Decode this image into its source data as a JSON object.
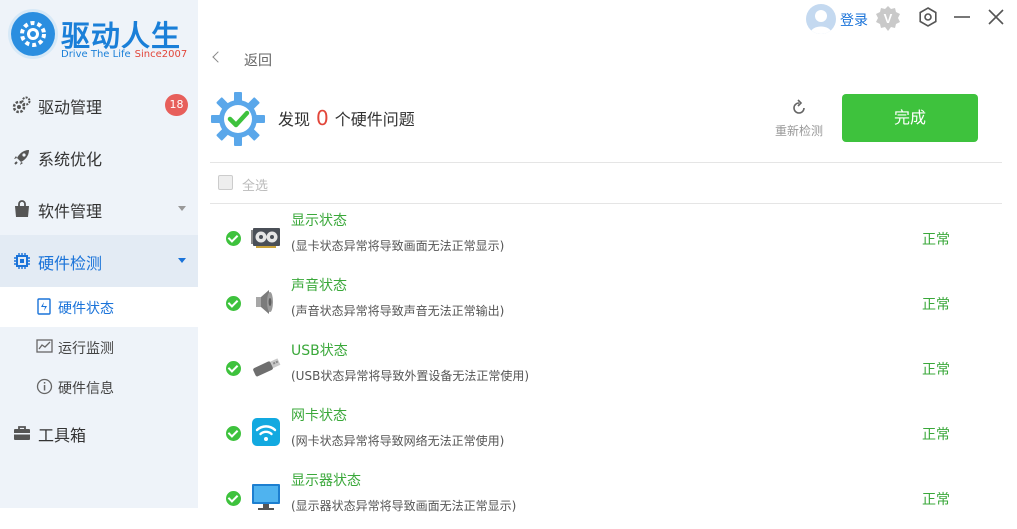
{
  "app": {
    "name": "驱动人生",
    "slogan": "Drive The Life",
    "since": "Since2007"
  },
  "sidebar": {
    "items": [
      {
        "label": "驱动管理",
        "badge": "18"
      },
      {
        "label": "系统优化"
      },
      {
        "label": "软件管理"
      },
      {
        "label": "硬件检测"
      },
      {
        "label": "工具箱"
      }
    ],
    "subitems": [
      {
        "label": "硬件状态"
      },
      {
        "label": "运行监测"
      },
      {
        "label": "硬件信息"
      }
    ]
  },
  "topbar": {
    "login_label": "登录",
    "vip_label": "V"
  },
  "main": {
    "back_label": "返回",
    "summary": {
      "prefix": "发现",
      "count": "0",
      "suffix": "个硬件问题"
    },
    "rescan_label": "重新检测",
    "done_label": "完成",
    "select_all_label": "全选",
    "rows": [
      {
        "title": "显示状态",
        "desc": "(显卡状态异常将导致画面无法正常显示)",
        "status": "正常",
        "icon": "graphics-card-icon"
      },
      {
        "title": "声音状态",
        "desc": "(声音状态异常将导致声音无法正常输出)",
        "status": "正常",
        "icon": "speaker-icon"
      },
      {
        "title": "USB状态",
        "desc": "(USB状态异常将导致外置设备无法正常使用)",
        "status": "正常",
        "icon": "usb-icon"
      },
      {
        "title": "网卡状态",
        "desc": "(网卡状态异常将导致网络无法正常使用)",
        "status": "正常",
        "icon": "wifi-icon"
      },
      {
        "title": "显示器状态",
        "desc": "(显示器状态异常将导致画面无法正常显示)",
        "status": "正常",
        "icon": "monitor-icon"
      }
    ]
  },
  "colors": {
    "accent": "#1a73d9",
    "success": "#3ec23d",
    "badge": "#e75f5b",
    "sidebar_bg": "#eef3f9"
  }
}
